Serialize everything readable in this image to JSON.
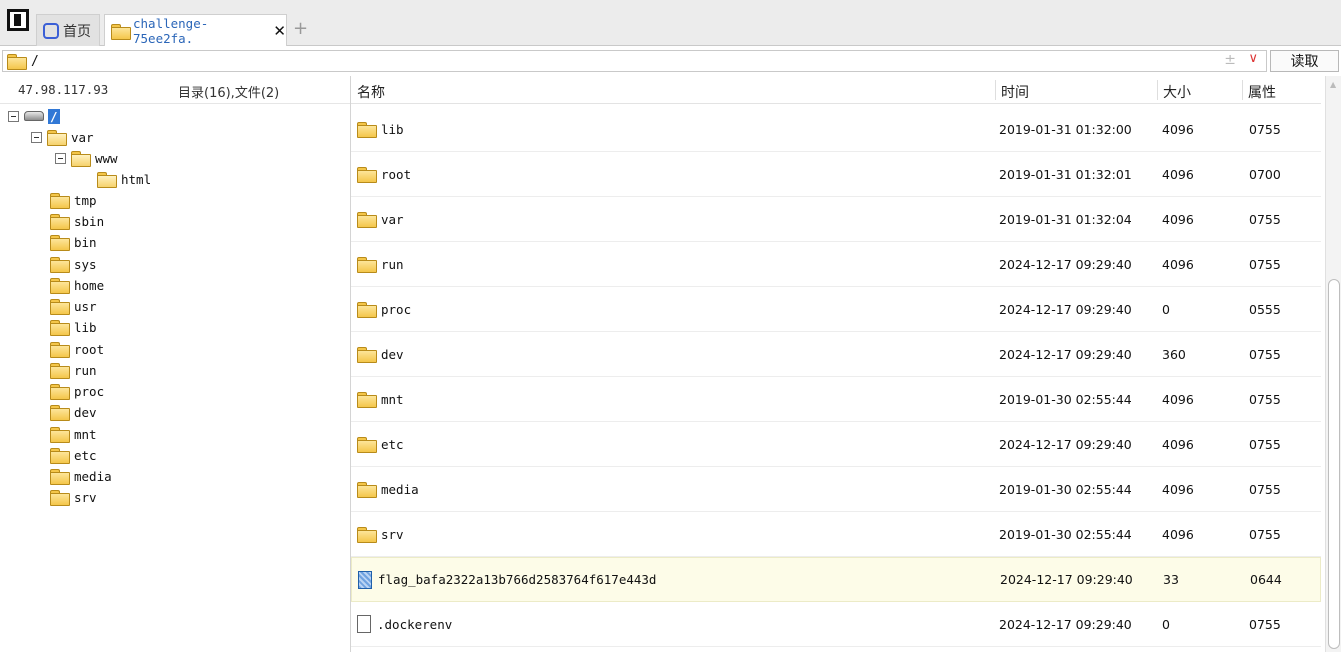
{
  "tabs": [
    {
      "label": "首页",
      "icon": "globe-icon"
    },
    {
      "label": "challenge-75ee2fa.",
      "icon": "folder-icon",
      "active": true
    }
  ],
  "add_tab": "+",
  "close_glyph": "✕",
  "path": {
    "value": "/",
    "plus": "±",
    "dropdown": "∨"
  },
  "read_button": "读取",
  "left": {
    "host": "47.98.117.93",
    "counts": "目录(16),文件(2)"
  },
  "tree": {
    "root": "/",
    "var": "var",
    "www": "www",
    "html": "html",
    "children": [
      "tmp",
      "sbin",
      "bin",
      "sys",
      "home",
      "usr",
      "lib",
      "root",
      "run",
      "proc",
      "dev",
      "mnt",
      "etc",
      "media",
      "srv"
    ]
  },
  "columns": {
    "name": "名称",
    "time": "时间",
    "size": "大小",
    "attr": "属性"
  },
  "rows": [
    {
      "type": "folder",
      "name": "lib",
      "time": "2019-01-31 01:32:00",
      "size": "4096",
      "attr": "0755"
    },
    {
      "type": "folder",
      "name": "root",
      "time": "2019-01-31 01:32:01",
      "size": "4096",
      "attr": "0700"
    },
    {
      "type": "folder",
      "name": "var",
      "time": "2019-01-31 01:32:04",
      "size": "4096",
      "attr": "0755"
    },
    {
      "type": "folder",
      "name": "run",
      "time": "2024-12-17 09:29:40",
      "size": "4096",
      "attr": "0755"
    },
    {
      "type": "folder",
      "name": "proc",
      "time": "2024-12-17 09:29:40",
      "size": "0",
      "attr": "0555"
    },
    {
      "type": "folder",
      "name": "dev",
      "time": "2024-12-17 09:29:40",
      "size": "360",
      "attr": "0755"
    },
    {
      "type": "folder",
      "name": "mnt",
      "time": "2019-01-30 02:55:44",
      "size": "4096",
      "attr": "0755"
    },
    {
      "type": "folder",
      "name": "etc",
      "time": "2024-12-17 09:29:40",
      "size": "4096",
      "attr": "0755"
    },
    {
      "type": "folder",
      "name": "media",
      "time": "2019-01-30 02:55:44",
      "size": "4096",
      "attr": "0755"
    },
    {
      "type": "folder",
      "name": "srv",
      "time": "2019-01-30 02:55:44",
      "size": "4096",
      "attr": "0755"
    },
    {
      "type": "file-blue",
      "name": "flag_bafa2322a13b766d2583764f617e443d",
      "time": "2024-12-17 09:29:40",
      "size": "33",
      "attr": "0644",
      "selected": true
    },
    {
      "type": "file",
      "name": ".dockerenv",
      "time": "2024-12-17 09:29:40",
      "size": "0",
      "attr": "0755"
    }
  ]
}
